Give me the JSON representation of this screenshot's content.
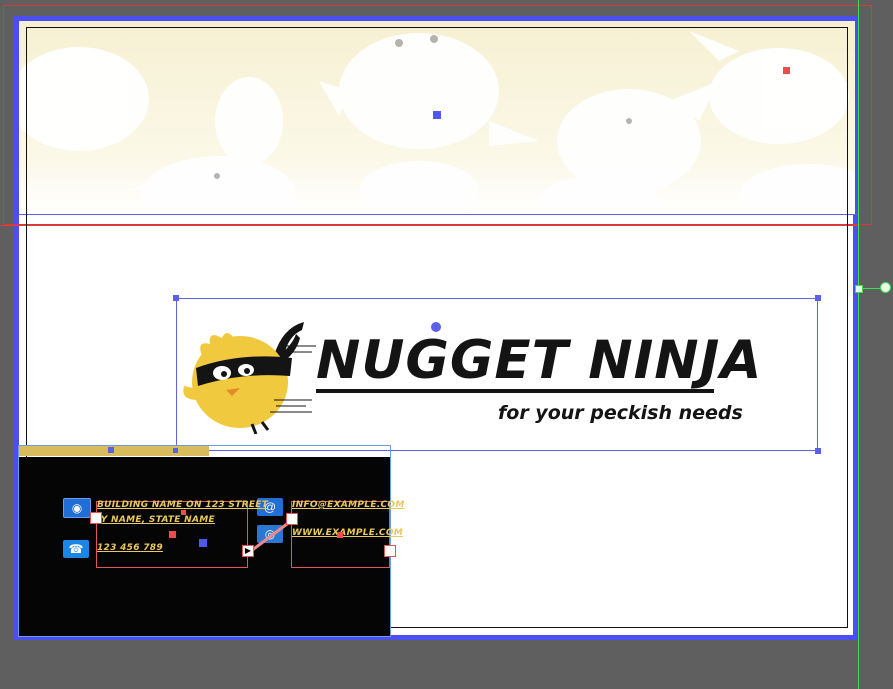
{
  "logo": {
    "title": "NUGGET NINJA",
    "tagline": "for your peckish needs"
  },
  "card": {
    "address_line1": "BUILDING NAME ON 123 STREET",
    "address_line2": "COUNTRY NAME, STATE NAME",
    "phone": "123 456 789",
    "email": "INFO@EXAMPLE.COM",
    "website": "WWW.EXAMPLE.COM",
    "icons": {
      "address": "location-pin-icon",
      "phone": "phone-icon",
      "email": "at-sign-icon",
      "web": "globe-icon"
    }
  },
  "colors": {
    "canvas": "#5f5f5f",
    "page_frame": "#4b4ef0",
    "bleed_guide": "#d33a3a",
    "smart_guide": "#3ddc52",
    "header_band": "#f6f0d2",
    "mascot_yellow": "#f0c93f",
    "card_background": "#050505",
    "card_text": "#e9c85e",
    "card_icon": "#1f6fd6"
  }
}
